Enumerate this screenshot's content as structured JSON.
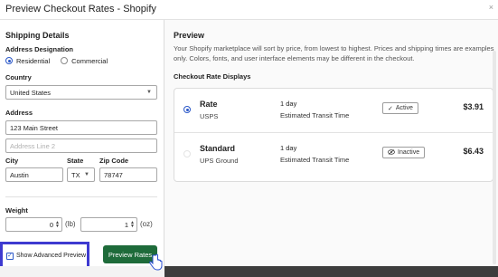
{
  "window": {
    "title": "Preview Checkout Rates - Shopify",
    "close_icon": "×"
  },
  "left": {
    "section_title": "Shipping Details",
    "address_designation_label": "Address Designation",
    "designation_options": [
      {
        "label": "Residential",
        "selected": true
      },
      {
        "label": "Commercial",
        "selected": false
      }
    ],
    "country_label": "Country",
    "country_value": "United States",
    "address_label": "Address",
    "address_line1_value": "123 Main Street",
    "address_line2_placeholder": "Address Line 2",
    "city_label": "City",
    "city_value": "Austin",
    "state_label": "State",
    "state_value": "TX",
    "zip_label": "Zip Code",
    "zip_value": "78747",
    "weight_label": "Weight",
    "weight_lb_value": "0",
    "weight_lb_unit": "(lb)",
    "weight_oz_value": "1",
    "weight_oz_unit": "(oz)",
    "advanced_label": "Show Advanced Preview",
    "advanced_checked": true,
    "preview_button": "Preview Rates"
  },
  "right": {
    "title": "Preview",
    "description": "Your Shopify marketplace will sort by price, from lowest to highest. Prices and shipping times are examples only. Colors, fonts, and user interface elements may be different in the checkout.",
    "subtitle": "Checkout Rate Displays",
    "rates": [
      {
        "name": "Rate",
        "carrier": "USPS",
        "days": "1 day",
        "transit": "Estimated Transit Time",
        "status": "Active",
        "status_icon": "check-icon",
        "price": "$3.91",
        "selected": true
      },
      {
        "name": "Standard",
        "carrier": "UPS Ground",
        "days": "1 day",
        "transit": "Estimated Transit Time",
        "status": "Inactive",
        "status_icon": "eye-off-icon",
        "price": "$6.43",
        "selected": false
      }
    ]
  },
  "colors": {
    "accent": "#2b58c8",
    "button": "#1e6b3a",
    "highlight": "#3e3ad0"
  }
}
